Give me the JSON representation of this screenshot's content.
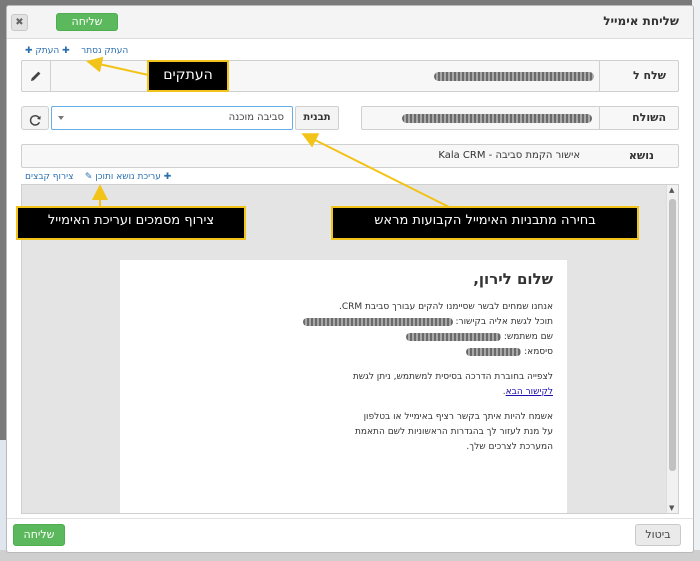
{
  "modal": {
    "title": "שליחת אימייל",
    "send_label": "שליחה",
    "cancel_label": "ביטול",
    "close_glyph": "✖"
  },
  "links": {
    "cc": "העתק",
    "bcc": "העתק נסתר",
    "attach": "צירוף קבצים",
    "edit_subject_content": "עריכת נושא ותוכן"
  },
  "fields": {
    "to_label": "שלח ל",
    "from_label": "השולח",
    "template_label": "תבנית",
    "template_value": "סביבה מוכנה",
    "subject_label": "נושא",
    "subject_value": "Kala CRM - אישור הקמת סביבה"
  },
  "letter": {
    "greeting": "שלום לירון,",
    "intro": "אנחנו שמחים לבשר שסיימנו להקים עבורך סביבת CRM.",
    "access_line": "תוכל לגשת אליה בקישור:",
    "username_label": "שם משתמש:",
    "password_label": "סיסמא:",
    "guide_line": "לצפייה בחוברת הדרכה בסיסית למשתמש, ניתן לגשת",
    "guide_link": "לקישור הבא",
    "closing_1": "אשמח להיות איתך בקשר רציף באימייל או בטלפון",
    "closing_2": "על מנת לעזור לך בהגדרות הראשוניות לשם התאמת",
    "closing_3": "המערכת לצרכים שלך."
  },
  "annotations": {
    "cc_callout": "העתקים",
    "templates_callout": "בחירה מתבניות האימייל הקבועות מראש",
    "attach_callout": "צירוף מסמכים ועריכת האימייל"
  },
  "colors": {
    "accent_green": "#5cb85c",
    "callout_border": "#f2c318",
    "link_blue": "#2a6fb0"
  },
  "icons": {
    "edit": "pencil-icon",
    "refresh": "refresh-icon",
    "plus": "plus-icon"
  }
}
